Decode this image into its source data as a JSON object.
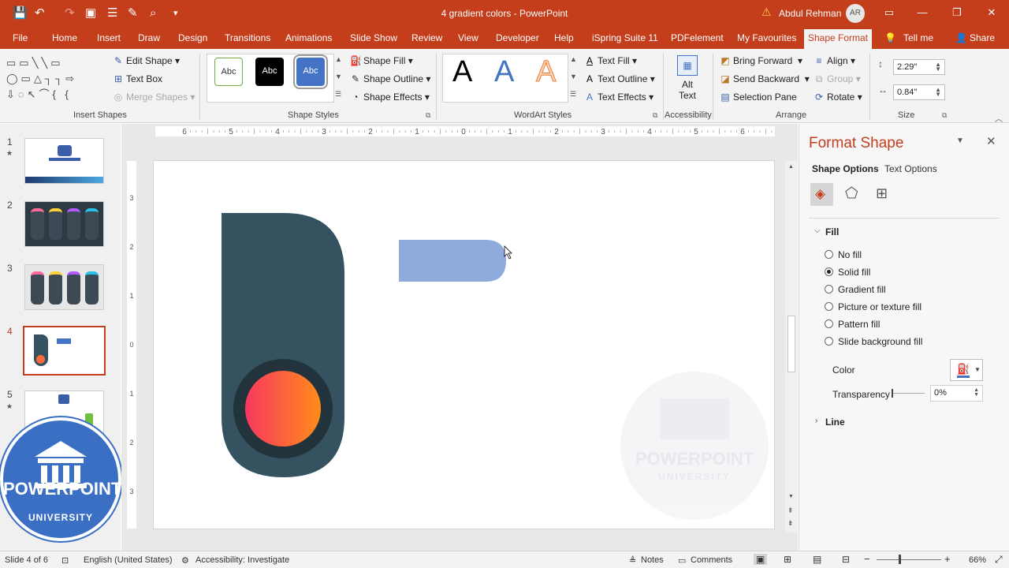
{
  "window": {
    "title": "4 gradient colors - PowerPoint",
    "user": "Abdul Rehman",
    "avatar": "AR"
  },
  "menu": {
    "tabs": [
      "File",
      "Home",
      "Insert",
      "Draw",
      "Design",
      "Transitions",
      "Animations",
      "Slide Show",
      "Review",
      "View",
      "Developer",
      "Help",
      "iSpring Suite 11",
      "PDFelement",
      "My Favourites"
    ],
    "active": "Shape Format",
    "tell_me": "Tell me",
    "share": "Share"
  },
  "ribbon": {
    "insert_shapes": {
      "label": "Insert Shapes",
      "edit_shape": "Edit Shape",
      "text_box": "Text Box",
      "merge_shapes": "Merge Shapes"
    },
    "shape_styles": {
      "label": "Shape Styles",
      "abc": "Abc",
      "fill": "Shape Fill",
      "outline": "Shape Outline",
      "effects": "Shape Effects"
    },
    "wordart": {
      "label": "WordArt Styles",
      "letter": "A",
      "text_fill": "Text Fill",
      "text_outline": "Text Outline",
      "text_effects": "Text Effects"
    },
    "accessibility": {
      "label": "Accessibility",
      "alt_text_1": "Alt",
      "alt_text_2": "Text"
    },
    "arrange": {
      "label": "Arrange",
      "bring_forward": "Bring Forward",
      "send_backward": "Send Backward",
      "selection_pane": "Selection Pane",
      "align": "Align",
      "group": "Group",
      "rotate": "Rotate"
    },
    "size": {
      "label": "Size",
      "height": "2.29\"",
      "width": "0.84\""
    }
  },
  "slides": [
    {
      "num": "1",
      "star": "★"
    },
    {
      "num": "2",
      "star": ""
    },
    {
      "num": "3",
      "star": ""
    },
    {
      "num": "4",
      "star": ""
    },
    {
      "num": "5",
      "star": "★"
    }
  ],
  "ruler": {
    "h": [
      "6",
      "5",
      "4",
      "3",
      "2",
      "1",
      "0",
      "1",
      "2",
      "3",
      "4",
      "5",
      "6"
    ],
    "v": [
      "3",
      "2",
      "1",
      "0",
      "1",
      "2",
      "3"
    ]
  },
  "watermark": {
    "line1": "POWERPOINT",
    "line2": "UNIVERSITY"
  },
  "pane": {
    "title": "Format Shape",
    "tabs": [
      "Shape Options",
      "Text Options"
    ],
    "fill_header": "Fill",
    "options": [
      "No fill",
      "Solid fill",
      "Gradient fill",
      "Picture or texture fill",
      "Pattern fill",
      "Slide background fill"
    ],
    "selected": "Solid fill",
    "color_label": "Color",
    "transparency_label": "Transparency",
    "transparency_value": "0%",
    "line_header": "Line"
  },
  "status": {
    "slide": "Slide 4 of 6",
    "language": "English (United States)",
    "accessibility": "Accessibility: Investigate",
    "notes": "Notes",
    "comments": "Comments",
    "zoom": "66%"
  },
  "colors": {
    "accent": "#c43e1c",
    "dark_shape": "#34525f",
    "blue_shape": "#8faadc",
    "ring": "#22333b",
    "grad_start": "#f8385f",
    "grad_end": "#ff8c1a"
  }
}
